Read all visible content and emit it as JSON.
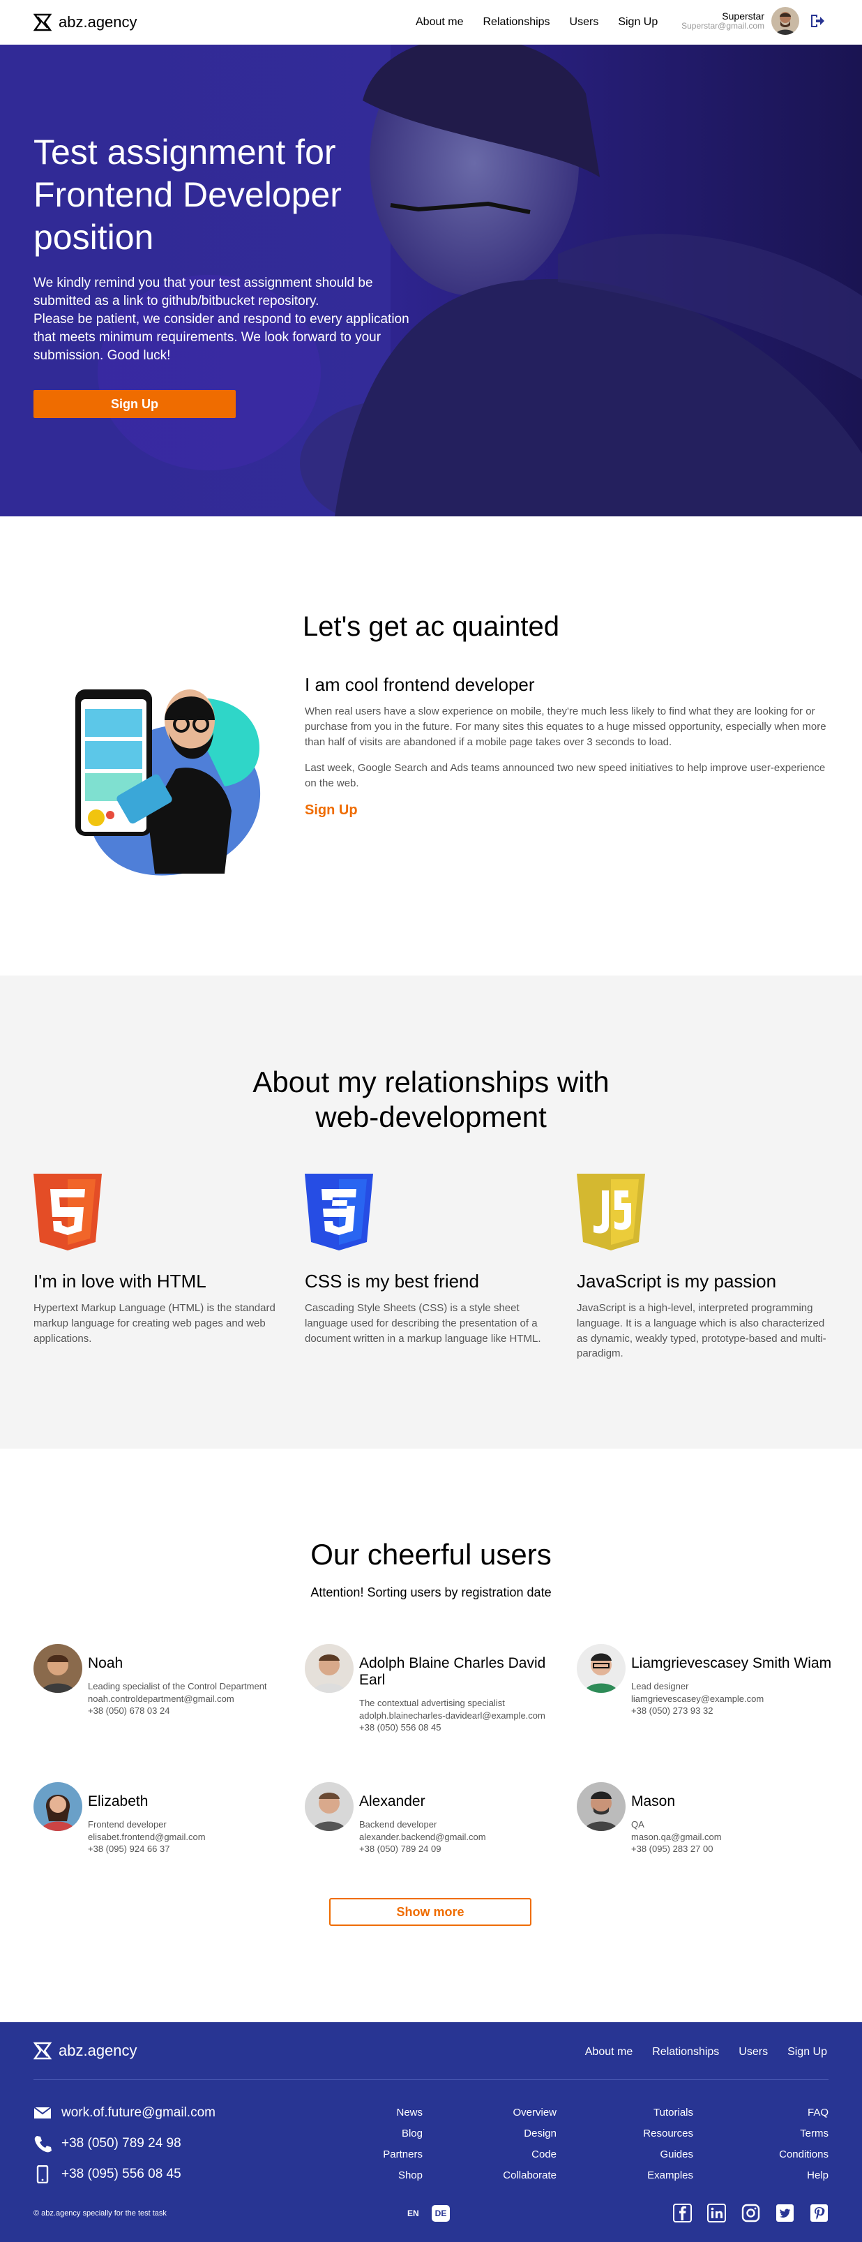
{
  "header": {
    "logo": "abz.agency",
    "nav": [
      "About me",
      "Relationships",
      "Users",
      "Sign Up"
    ],
    "user_name": "Superstar",
    "user_email": "Superstar@gmail.com"
  },
  "hero": {
    "title": "Test assignment for Frontend Developer position",
    "line1": "We kindly remind you that your test assignment should be submitted as a link to github/bitbucket repository.",
    "line2": "Please be patient, we consider and respond to every application that meets minimum requirements. We look forward to your submission. Good luck!",
    "button": "Sign Up"
  },
  "acquainted": {
    "title": "Let's get ac quainted",
    "heading": "I am cool frontend developer",
    "p1": "When real users have a slow experience on mobile, they're much less likely to find what they are looking for or purchase from you in the future. For many sites this equates to a huge missed opportunity, especially when more than half of visits are abandoned if a mobile page takes over 3 seconds to load.",
    "p2": "Last week, Google Search and Ads teams announced two new speed initiatives to help improve user-experience on the web.",
    "link": "Sign Up"
  },
  "relationships": {
    "title_l1": "About my relationships with",
    "title_l2": "web-development",
    "items": [
      {
        "title": "I'm in love with HTML",
        "text": "Hypertext Markup Language (HTML) is the standard markup language for creating web pages and web applications.",
        "color": "#e44d26"
      },
      {
        "title": "CSS is my best friend",
        "text": "Cascading Style Sheets (CSS) is a  style sheet language used for describing the presentation of a document written in a markup language like HTML.",
        "color": "#264de4"
      },
      {
        "title": "JavaScript is my passion",
        "text": "JavaScript is a high-level, interpreted programming language. It is a language which is also characterized as dynamic, weakly typed, prototype-based and multi-paradigm.",
        "color": "#d4b830"
      }
    ]
  },
  "users": {
    "title": "Our cheerful users",
    "subtitle": "Attention! Sorting users by registration date",
    "list": [
      {
        "name": "Noah",
        "position": "Leading specialist of the Control Department",
        "email": "noah.controldepartment@gmail.com",
        "phone": "+38 (050) 678 03 24"
      },
      {
        "name": "Adolph Blaine Charles David Earl",
        "position": "The contextual advertising specialist",
        "email": "adolph.blainecharles-davidearl@example.com",
        "phone": "+38 (050) 556 08 45"
      },
      {
        "name": "Liamgrievescasey Smith Wiam",
        "position": "Lead designer",
        "email": "liamgrievescasey@example.com",
        "phone": "+38 (050) 273 93 32"
      },
      {
        "name": "Elizabeth",
        "position": "Frontend developer",
        "email": "elisabet.frontend@gmail.com",
        "phone": "+38 (095) 924 66 37"
      },
      {
        "name": "Alexander",
        "position": "Backend developer",
        "email": "alexander.backend@gmail.com",
        "phone": "+38 (050) 789 24 09"
      },
      {
        "name": "Mason",
        "position": "QA",
        "email": "mason.qa@gmail.com",
        "phone": "+38 (095) 283 27 00"
      }
    ],
    "show_more": "Show more"
  },
  "footer": {
    "logo": "abz.agency",
    "nav": [
      "About me",
      "Relationships",
      "Users",
      "Sign Up"
    ],
    "email": "work.of.future@gmail.com",
    "phone1": "+38 (050) 789 24 98",
    "phone2": "+38 (095) 556 08 45",
    "links": [
      [
        "News",
        "Blog",
        "Partners",
        "Shop"
      ],
      [
        "Overview",
        "Design",
        "Code",
        "Collaborate"
      ],
      [
        "Tutorials",
        "Resources",
        "Guides",
        "Examples"
      ],
      [
        "FAQ",
        "Terms",
        "Conditions",
        "Help"
      ]
    ],
    "copyright": "© abz.agency specially for the test task",
    "lang_en": "EN",
    "lang_de": "DE"
  },
  "colors": {
    "accent": "#ef6c00",
    "footer_bg": "#283593",
    "hero_overlay": "#2a1f8a"
  }
}
